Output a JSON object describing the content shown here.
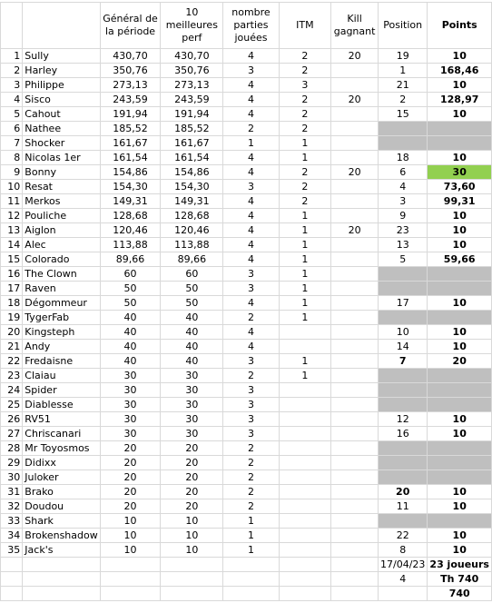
{
  "headers": [
    "",
    "",
    "Général de la période",
    "10 meilleures perf",
    "nombre parties jouées",
    "ITM",
    "Kill gagnant",
    "Position",
    "Points"
  ],
  "colors": {
    "grey": "#bfbfbf",
    "green": "#92d050"
  },
  "rows": [
    [
      "1",
      "Sully",
      "430,70",
      "430,70",
      "4",
      "2",
      "20",
      "19",
      "10"
    ],
    [
      "2",
      "Harley",
      "350,76",
      "350,76",
      "3",
      "2",
      "",
      "1",
      "168,46"
    ],
    [
      "3",
      "Philippe",
      "273,13",
      "273,13",
      "4",
      "3",
      "",
      "21",
      "10"
    ],
    [
      "4",
      "Sisco",
      "243,59",
      "243,59",
      "4",
      "2",
      "20",
      "2",
      "128,97"
    ],
    [
      "5",
      "Cahout",
      "191,94",
      "191,94",
      "4",
      "2",
      "",
      "15",
      "10"
    ],
    [
      "6",
      "Nathee",
      "185,52",
      "185,52",
      "2",
      "2",
      "",
      "",
      ""
    ],
    [
      "7",
      "Shocker",
      "161,67",
      "161,67",
      "1",
      "1",
      "",
      "",
      ""
    ],
    [
      "8",
      "Nicolas 1er",
      "161,54",
      "161,54",
      "4",
      "1",
      "",
      "18",
      "10"
    ],
    [
      "9",
      "Bonny",
      "154,86",
      "154,86",
      "4",
      "2",
      "20",
      "6",
      "30"
    ],
    [
      "10",
      "Resat",
      "154,30",
      "154,30",
      "3",
      "2",
      "",
      "4",
      "73,60"
    ],
    [
      "11",
      "Merkos",
      "149,31",
      "149,31",
      "4",
      "2",
      "",
      "3",
      "99,31"
    ],
    [
      "12",
      "Pouliche",
      "128,68",
      "128,68",
      "4",
      "1",
      "",
      "9",
      "10"
    ],
    [
      "13",
      "Aiglon",
      "120,46",
      "120,46",
      "4",
      "1",
      "20",
      "23",
      "10"
    ],
    [
      "14",
      "Alec",
      "113,88",
      "113,88",
      "4",
      "1",
      "",
      "13",
      "10"
    ],
    [
      "15",
      "Colorado",
      "89,66",
      "89,66",
      "4",
      "1",
      "",
      "5",
      "59,66"
    ],
    [
      "16",
      "The Clown",
      "60",
      "60",
      "3",
      "1",
      "",
      "",
      ""
    ],
    [
      "17",
      "Raven",
      "50",
      "50",
      "3",
      "1",
      "",
      "",
      ""
    ],
    [
      "18",
      "Dégommeur",
      "50",
      "50",
      "4",
      "1",
      "",
      "17",
      "10"
    ],
    [
      "19",
      "TygerFab",
      "40",
      "40",
      "2",
      "1",
      "",
      "",
      ""
    ],
    [
      "20",
      "Kingsteph",
      "40",
      "40",
      "4",
      "",
      "",
      "10",
      "10"
    ],
    [
      "21",
      "Andy",
      "40",
      "40",
      "4",
      "",
      "",
      "14",
      "10"
    ],
    [
      "22",
      "Fredaisne",
      "40",
      "40",
      "3",
      "1",
      "",
      "7",
      "20"
    ],
    [
      "23",
      "Claiau",
      "30",
      "30",
      "2",
      "1",
      "",
      "",
      ""
    ],
    [
      "24",
      "Spider",
      "30",
      "30",
      "3",
      "",
      "",
      "",
      ""
    ],
    [
      "25",
      "Diablesse",
      "30",
      "30",
      "3",
      "",
      "",
      "",
      ""
    ],
    [
      "26",
      "RV51",
      "30",
      "30",
      "3",
      "",
      "",
      "12",
      "10"
    ],
    [
      "27",
      "Chriscanari",
      "30",
      "30",
      "3",
      "",
      "",
      "16",
      "10"
    ],
    [
      "28",
      "Mr Toyosmos",
      "20",
      "20",
      "2",
      "",
      "",
      "",
      ""
    ],
    [
      "29",
      "Didixx",
      "20",
      "20",
      "2",
      "",
      "",
      "",
      ""
    ],
    [
      "30",
      "Juloker",
      "20",
      "20",
      "2",
      "",
      "",
      "",
      ""
    ],
    [
      "31",
      "Brako",
      "20",
      "20",
      "2",
      "",
      "",
      "20",
      "10"
    ],
    [
      "32",
      "Doudou",
      "20",
      "20",
      "2",
      "",
      "",
      "11",
      "10"
    ],
    [
      "33",
      "Shark",
      "10",
      "10",
      "1",
      "",
      "",
      "",
      ""
    ],
    [
      "34",
      "Brokenshadow",
      "10",
      "10",
      "1",
      "",
      "",
      "22",
      "10"
    ],
    [
      "35",
      "Jack's",
      "10",
      "10",
      "1",
      "",
      "",
      "8",
      "10"
    ]
  ],
  "grey_rows": [
    6,
    7,
    16,
    17,
    19,
    23,
    24,
    25,
    28,
    29,
    30,
    33
  ],
  "green_points_rows": [
    9
  ],
  "bold_position_rows": [
    22,
    31
  ],
  "footer": [
    {
      "position": "17/04/23",
      "points": "23 joueurs"
    },
    {
      "position": "4",
      "points": "Th 740"
    },
    {
      "position": "",
      "points": "740"
    }
  ]
}
